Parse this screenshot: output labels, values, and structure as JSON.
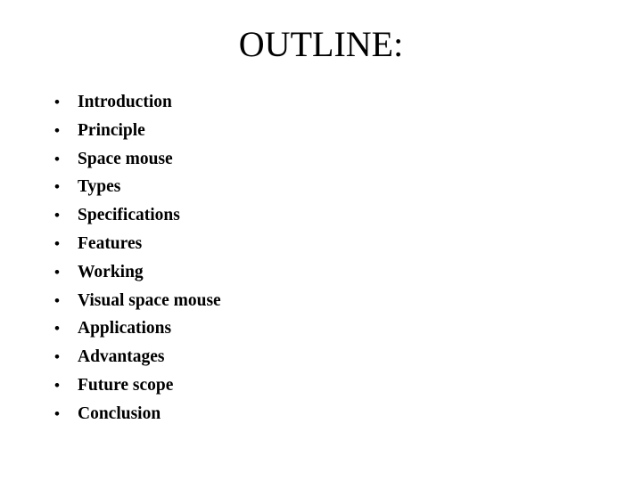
{
  "slide": {
    "title": "OUTLINE:",
    "background_color": "#ffffff",
    "text_color": "#000000",
    "bullet_glyph": "•",
    "items": [
      {
        "label": "Introduction"
      },
      {
        "label": "Principle"
      },
      {
        "label": "Space mouse"
      },
      {
        "label": "Types"
      },
      {
        "label": "Specifications"
      },
      {
        "label": "Features"
      },
      {
        "label": "Working"
      },
      {
        "label": "Visual space mouse"
      },
      {
        "label": "Applications"
      },
      {
        "label": "Advantages"
      },
      {
        "label": "Future scope"
      },
      {
        "label": "Conclusion"
      }
    ]
  }
}
